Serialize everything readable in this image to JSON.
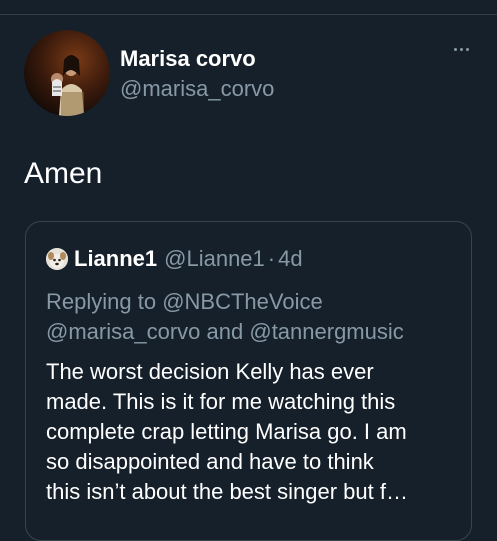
{
  "tweet": {
    "author": {
      "display_name": "Marisa corvo",
      "handle": "@marisa_corvo",
      "avatar": "avatar-photo"
    },
    "text": "Amen",
    "more_icon": "more-horizontal-icon"
  },
  "quoted_tweet": {
    "author": {
      "display_name": "Lianne1",
      "handle": "@Lianne1",
      "avatar": "dog-avatar"
    },
    "separator": "·",
    "time": "4d",
    "replying_prefix": "Replying to",
    "replying_to": [
      "@NBCTheVoice",
      "@marisa_corvo",
      "@tannergmusic"
    ],
    "replying_and": "and",
    "body_lines": [
      "The worst decision Kelly has ever",
      "made. This is it for me watching this",
      "complete crap letting Marisa go. I am",
      "so disappointed and have to think",
      "this isn’t about the best singer but f…"
    ]
  },
  "colors": {
    "background": "#15202b",
    "text": "#ffffff",
    "muted": "#8899a6",
    "border": "#38444d"
  }
}
